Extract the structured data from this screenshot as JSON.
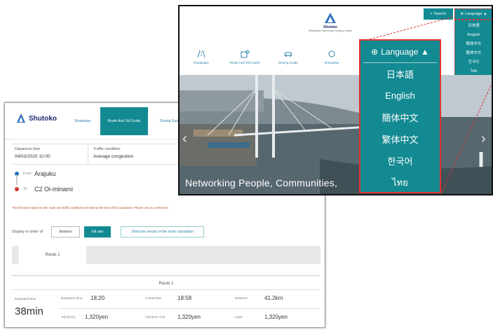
{
  "back_window": {
    "logo_text": "Shutoko",
    "nav": [
      "Roadways",
      "Route And Toll Guide",
      "Driving Guide"
    ],
    "departure_label": "Departure time",
    "departure_value": "04/03/2020 10:00",
    "traffic_label": "Traffic condition",
    "traffic_value": "Average congestion",
    "from_label": "From",
    "from_value": "Arajuku",
    "to_label": "To",
    "to_value": "C2 Oi-minami",
    "notice": "The toll rate is based on the route and traffic conditions selected at the time of the calculation. Please use as a reference.",
    "order_label": "Display in order of",
    "order_options": [
      "distance",
      "toll rate"
    ],
    "order_selected": "toll rate",
    "compare_button": "Show the results of the route calculation",
    "tab": "Route 1",
    "route_title": "Route 1",
    "required_time_label": "Estimated time",
    "required_time": "38min",
    "departure_time_label": "Departure time",
    "departure_time": "18:20",
    "arrival_label": "Arrival time",
    "arrival_time": "18:58",
    "distance_label": "Distance",
    "distance": "41.2km",
    "toll_etc_label": "Toll (ETC)",
    "toll_etc": "1,320yen",
    "toll_etc2_label": "Toll (ETC 2.0)",
    "toll_etc2": "1,320yen",
    "cash_label": "Cash",
    "cash": "1,320yen"
  },
  "front_window": {
    "logo_name": "Shutoko",
    "logo_sub": "Metropolitan Expressway Company Limited",
    "search_label": "Search",
    "language_label": "Language ▲",
    "nav": [
      "Roadways",
      "Route And Toll Guide",
      "Driving Guide",
      "Innovative"
    ],
    "hero_caption": "Networking People, Communities,",
    "languages": [
      "日本語",
      "English",
      "簡体中文",
      "繁体中文",
      "한국어",
      "ไทย"
    ]
  },
  "zoomed_dropdown": {
    "header": "Language ▲",
    "languages": [
      "日本語",
      "English",
      "簡体中文",
      "繁体中文",
      "한국어",
      "ไทย"
    ]
  },
  "colors": {
    "accent": "#138a92",
    "callout": "#d33333",
    "brand": "#1a2a6c"
  }
}
